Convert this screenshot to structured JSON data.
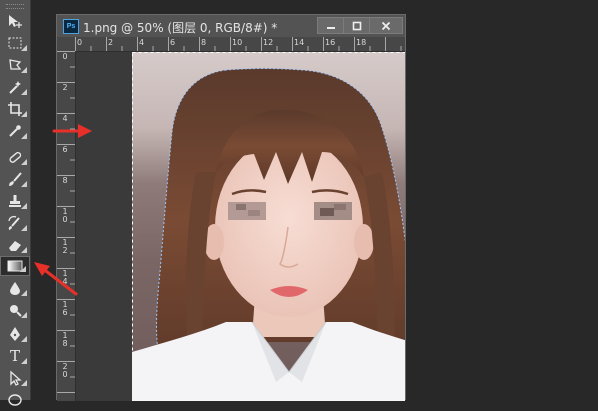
{
  "app": {
    "name": "Adobe Photoshop",
    "badge": "Ps"
  },
  "document": {
    "title": "1.png @ 50% (图层 0, RGB/8#) *",
    "zoom": "50%",
    "layer": "图层 0",
    "mode": "RGB/8#"
  },
  "window_controls": {
    "minimize": "—",
    "maximize": "□",
    "close": "✕"
  },
  "ruler": {
    "horizontal_labels": [
      "0",
      "2",
      "4",
      "6",
      "8",
      "10",
      "12",
      "14",
      "16",
      "18"
    ],
    "vertical_labels": [
      "0",
      "2",
      "4",
      "6",
      "8",
      "10",
      "12",
      "14",
      "16",
      "18",
      "20"
    ]
  },
  "tools": [
    {
      "icon": "move-tool-icon",
      "glyph": "▶+"
    },
    {
      "icon": "rectangular-marquee-tool-icon",
      "glyph": "⬚"
    },
    {
      "icon": "lasso-tool-icon",
      "glyph": "⌒"
    },
    {
      "icon": "magic-wand-tool-icon",
      "glyph": "✴"
    },
    {
      "icon": "crop-tool-icon",
      "glyph": "⌗"
    },
    {
      "icon": "eyedropper-tool-icon",
      "glyph": "⁄"
    },
    {
      "icon": "healing-brush-tool-icon",
      "glyph": "✂"
    },
    {
      "icon": "brush-tool-icon",
      "glyph": "✎"
    },
    {
      "icon": "clone-stamp-tool-icon",
      "glyph": "⚒"
    },
    {
      "icon": "history-brush-tool-icon",
      "glyph": "↻"
    },
    {
      "icon": "eraser-tool-icon",
      "glyph": "▭"
    },
    {
      "icon": "gradient-tool-icon",
      "glyph": "▤",
      "active": true
    },
    {
      "icon": "blur-tool-icon",
      "glyph": "▲"
    },
    {
      "icon": "dodge-tool-icon",
      "glyph": "●"
    },
    {
      "icon": "pen-tool-icon",
      "glyph": "✒"
    },
    {
      "icon": "type-tool-icon",
      "glyph": "T"
    },
    {
      "icon": "path-selection-tool-icon",
      "glyph": "↖"
    },
    {
      "icon": "ellipse-tool-icon",
      "glyph": "◯"
    }
  ],
  "annotations": [
    {
      "icon": "red-arrow-icon",
      "points_to": "canvas"
    },
    {
      "icon": "red-arrow-icon",
      "points_to": "gradient-tool"
    }
  ],
  "colors": {
    "panel": "#535353",
    "workspace": "#282828",
    "accent_arrow": "#e8302a",
    "ps_blue": "#4fb4ff"
  }
}
